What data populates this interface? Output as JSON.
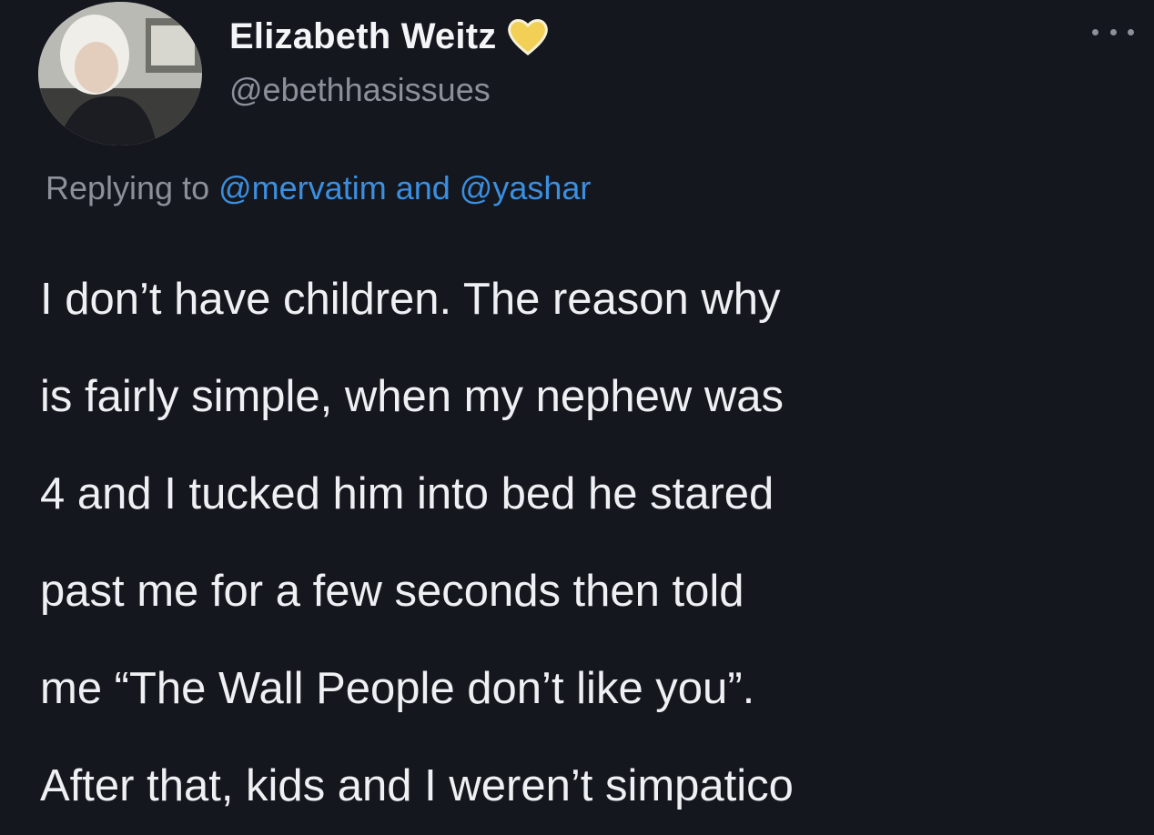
{
  "tweet": {
    "author": {
      "display_name": "Elizabeth Weitz",
      "handle": "@ebethhasissues",
      "badge_icon": "yellow-heart-icon",
      "badge_color": "#f2cf55"
    },
    "more_icon": "more-options-icon",
    "reply": {
      "prefix": "Replying to",
      "mention_1": "@mervatim",
      "conjunction": "and",
      "mention_2": "@yashar",
      "mention_color": "#3b8fe0"
    },
    "body_lines": [
      "I don’t have children. The reason why",
      "is fairly simple, when my nephew was",
      "4 and I tucked him into bed he stared",
      "past me for a few seconds then told",
      "me “The Wall People don’t like you”.",
      "After that, kids and I weren’t simpatico"
    ]
  },
  "colors": {
    "background": "#15171e",
    "text": "#eef0f3",
    "secondary_text": "#8b909a"
  }
}
